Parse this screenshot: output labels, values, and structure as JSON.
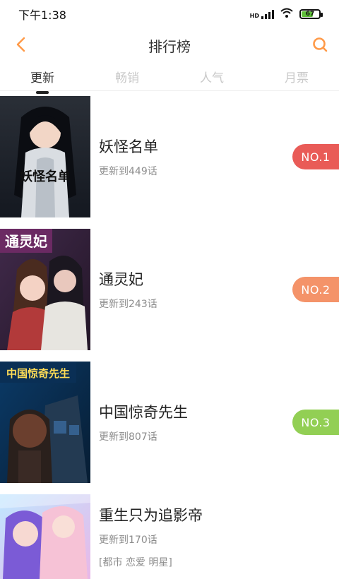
{
  "status": {
    "time": "下午1:38",
    "network_label": "HD",
    "battery": "67"
  },
  "header": {
    "title": "排行榜",
    "accent": "#ff9a48"
  },
  "tabs": [
    {
      "label": "更新",
      "active": true
    },
    {
      "label": "畅销",
      "active": false
    },
    {
      "label": "人气",
      "active": false
    },
    {
      "label": "月票",
      "active": false
    }
  ],
  "items": [
    {
      "title": "妖怪名单",
      "sub": "更新到449话",
      "rank": "NO.1",
      "rank_color": "#e95b57",
      "cover_text": "妖怪名单"
    },
    {
      "title": "通灵妃",
      "sub": "更新到243话",
      "rank": "NO.2",
      "rank_color": "#f49369",
      "cover_text": "通灵妃"
    },
    {
      "title": "中国惊奇先生",
      "sub": "更新到807话",
      "rank": "NO.3",
      "rank_color": "#92cf54",
      "cover_text": "中国惊奇先生"
    },
    {
      "title": "重生只为追影帝",
      "sub": "更新到170话",
      "tags": "[都市  恋爱  明星]"
    }
  ]
}
